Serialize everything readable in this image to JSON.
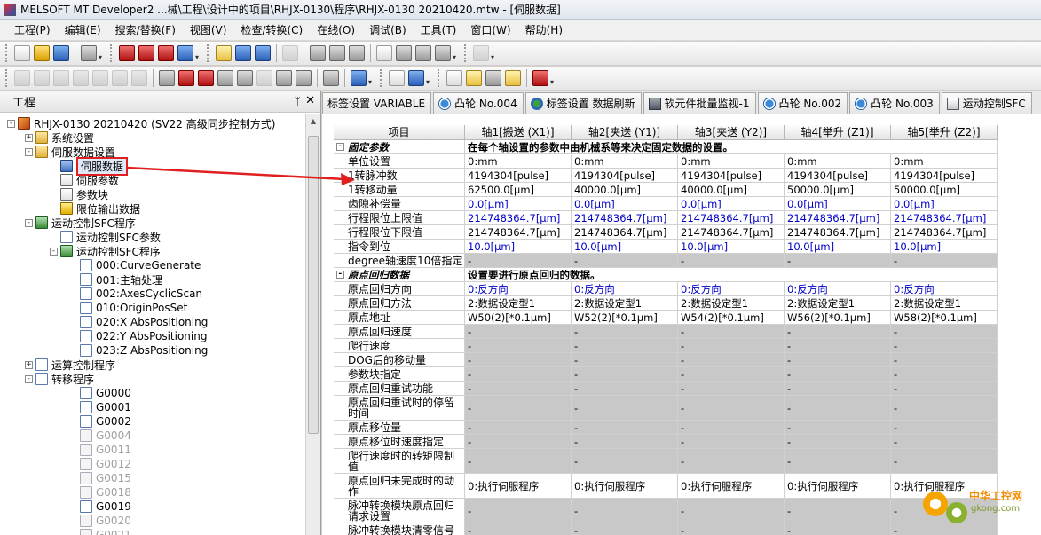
{
  "window": {
    "title": "MELSOFT MT Developer2 ...械\\工程\\设计中的项目\\RHJX-0130\\程序\\RHJX-0130 20210420.mtw - [伺服数据]"
  },
  "menu": [
    "工程(P)",
    "编辑(E)",
    "搜索/替换(F)",
    "视图(V)",
    "检查/转换(C)",
    "在线(O)",
    "调试(B)",
    "工具(T)",
    "窗口(W)",
    "帮助(H)"
  ],
  "panel": {
    "title": "工程",
    "pin": "ᛘ",
    "close": "✕"
  },
  "tree": [
    {
      "label": "RHJX-0130 20210420 (SV22 高级同步控制方式)",
      "indent": 0,
      "exp": "-",
      "icon": "proj"
    },
    {
      "label": "系统设置",
      "indent": 1,
      "exp": "+",
      "icon": "folder"
    },
    {
      "label": "伺服数据设置",
      "indent": 1,
      "exp": "-",
      "icon": "folder"
    },
    {
      "label": "伺服数据",
      "indent": 2,
      "exp": "",
      "icon": "servo",
      "highlight": true
    },
    {
      "label": "伺服参数",
      "indent": 2,
      "exp": "",
      "icon": "blk"
    },
    {
      "label": "参数块",
      "indent": 2,
      "exp": "",
      "icon": "blk"
    },
    {
      "label": "限位输出数据",
      "indent": 2,
      "exp": "",
      "icon": "yel"
    },
    {
      "label": "运动控制SFC程序",
      "indent": 1,
      "exp": "-",
      "icon": "sfc"
    },
    {
      "label": "运动控制SFC参数",
      "indent": 2,
      "exp": "",
      "icon": "doc"
    },
    {
      "label": "运动控制SFC程序",
      "indent": 2,
      "exp": "-",
      "icon": "sfc"
    },
    {
      "label": "000:CurveGenerate",
      "indent": 3,
      "exp": "",
      "icon": "doc"
    },
    {
      "label": "001:主轴处理",
      "indent": 3,
      "exp": "",
      "icon": "doc"
    },
    {
      "label": "002:AxesCyclicScan",
      "indent": 3,
      "exp": "",
      "icon": "doc"
    },
    {
      "label": "010:OriginPosSet",
      "indent": 3,
      "exp": "",
      "icon": "doc"
    },
    {
      "label": "020:X AbsPositioning",
      "indent": 3,
      "exp": "",
      "icon": "doc"
    },
    {
      "label": "022:Y AbsPositioning",
      "indent": 3,
      "exp": "",
      "icon": "doc"
    },
    {
      "label": "023:Z AbsPositioning",
      "indent": 3,
      "exp": "",
      "icon": "doc"
    },
    {
      "label": "运算控制程序",
      "indent": 1,
      "exp": "+",
      "icon": "doc"
    },
    {
      "label": "转移程序",
      "indent": 1,
      "exp": "-",
      "icon": "doc"
    },
    {
      "label": "G0000",
      "indent": 3,
      "exp": "",
      "icon": "doc"
    },
    {
      "label": "G0001",
      "indent": 3,
      "exp": "",
      "icon": "doc"
    },
    {
      "label": "G0002",
      "indent": 3,
      "exp": "",
      "icon": "doc"
    },
    {
      "label": "G0004",
      "indent": 3,
      "exp": "",
      "icon": "gdoc",
      "dim": true
    },
    {
      "label": "G0011",
      "indent": 3,
      "exp": "",
      "icon": "gdoc",
      "dim": true
    },
    {
      "label": "G0012",
      "indent": 3,
      "exp": "",
      "icon": "gdoc",
      "dim": true
    },
    {
      "label": "G0015",
      "indent": 3,
      "exp": "",
      "icon": "gdoc",
      "dim": true
    },
    {
      "label": "G0018",
      "indent": 3,
      "exp": "",
      "icon": "gdoc",
      "dim": true
    },
    {
      "label": "G0019",
      "indent": 3,
      "exp": "",
      "icon": "doc"
    },
    {
      "label": "G0020",
      "indent": 3,
      "exp": "",
      "icon": "gdoc",
      "dim": true
    },
    {
      "label": "G0021",
      "indent": 3,
      "exp": "",
      "icon": "gdoc",
      "dim": true
    }
  ],
  "tabs": [
    {
      "label": "标签设置 VARIABLE",
      "icon": ""
    },
    {
      "label": "凸轮 No.004",
      "icon": "cam"
    },
    {
      "label": "标签设置 数据刷新",
      "icon": "refresh"
    },
    {
      "label": "软元件批量监视-1",
      "icon": "dev"
    },
    {
      "label": "凸轮 No.002",
      "icon": "cam"
    },
    {
      "label": "凸轮 No.003",
      "icon": "cam"
    },
    {
      "label": "运动控制SFC",
      "icon": "sfc"
    }
  ],
  "grid": {
    "headers": [
      "项目",
      "轴1[搬送 (X1)]",
      "轴2[夹送 (Y1)]",
      "轴3[夹送 (Y2)]",
      "轴4[举升 (Z1)]",
      "轴5[举升 (Z2)]"
    ],
    "rows": [
      {
        "type": "section",
        "label": "固定参数",
        "desc": "在每个轴设置的参数中由机械系等来决定固定数据的设置。"
      },
      {
        "label": "单位设置",
        "values": [
          "0:mm",
          "0:mm",
          "0:mm",
          "0:mm",
          "0:mm"
        ]
      },
      {
        "label": "1转脉冲数",
        "values": [
          "4194304[pulse]",
          "4194304[pulse]",
          "4194304[pulse]",
          "4194304[pulse]",
          "4194304[pulse]"
        ]
      },
      {
        "label": "1转移动量",
        "values": [
          "62500.0[μm]",
          "40000.0[μm]",
          "40000.0[μm]",
          "50000.0[μm]",
          "50000.0[μm]"
        ]
      },
      {
        "label": "齿隙补偿量",
        "values": [
          "0.0[μm]",
          "0.0[μm]",
          "0.0[μm]",
          "0.0[μm]",
          "0.0[μm]"
        ],
        "blue": true
      },
      {
        "label": "行程限位上限值",
        "values": [
          "214748364.7[μm]",
          "214748364.7[μm]",
          "214748364.7[μm]",
          "214748364.7[μm]",
          "214748364.7[μm]"
        ],
        "blue": true
      },
      {
        "label": "行程限位下限值",
        "values": [
          "214748364.7[μm]",
          "214748364.7[μm]",
          "214748364.7[μm]",
          "214748364.7[μm]",
          "214748364.7[μm]"
        ]
      },
      {
        "label": "指令到位",
        "values": [
          "10.0[μm]",
          "10.0[μm]",
          "10.0[μm]",
          "10.0[μm]",
          "10.0[μm]"
        ],
        "blue": true
      },
      {
        "label": "degree轴速度10倍指定",
        "values": [
          "-",
          "-",
          "-",
          "-",
          "-"
        ],
        "gray": true
      },
      {
        "type": "section",
        "label": "原点回归数据",
        "desc": "设置要进行原点回归的数据。"
      },
      {
        "label": "原点回归方向",
        "values": [
          "0:反方向",
          "0:反方向",
          "0:反方向",
          "0:反方向",
          "0:反方向"
        ],
        "blue": true
      },
      {
        "label": "原点回归方法",
        "values": [
          "2:数据设定型1",
          "2:数据设定型1",
          "2:数据设定型1",
          "2:数据设定型1",
          "2:数据设定型1"
        ]
      },
      {
        "label": "原点地址",
        "values": [
          "W50(2)[*0.1μm]",
          "W52(2)[*0.1μm]",
          "W54(2)[*0.1μm]",
          "W56(2)[*0.1μm]",
          "W58(2)[*0.1μm]"
        ]
      },
      {
        "label": "原点回归速度",
        "values": [
          "-",
          "-",
          "-",
          "-",
          "-"
        ],
        "gray": true
      },
      {
        "label": "爬行速度",
        "values": [
          "-",
          "-",
          "-",
          "-",
          "-"
        ],
        "gray": true
      },
      {
        "label": "DOG后的移动量",
        "values": [
          "-",
          "-",
          "-",
          "-",
          "-"
        ],
        "gray": true
      },
      {
        "label": "参数块指定",
        "values": [
          "-",
          "-",
          "-",
          "-",
          "-"
        ],
        "gray": true
      },
      {
        "label": "原点回归重试功能",
        "values": [
          "-",
          "-",
          "-",
          "-",
          "-"
        ],
        "gray": true
      },
      {
        "label": "原点回归重试时的停留时间",
        "values": [
          "-",
          "-",
          "-",
          "-",
          "-"
        ],
        "gray": true,
        "tall": true
      },
      {
        "label": "原点移位量",
        "values": [
          "-",
          "-",
          "-",
          "-",
          "-"
        ],
        "gray": true
      },
      {
        "label": "原点移位时速度指定",
        "values": [
          "-",
          "-",
          "-",
          "-",
          "-"
        ],
        "gray": true
      },
      {
        "label": "爬行速度时的转矩限制值",
        "values": [
          "-",
          "-",
          "-",
          "-",
          "-"
        ],
        "gray": true,
        "tall": true
      },
      {
        "label": "原点回归未完成时的动作",
        "values": [
          "0:执行伺服程序",
          "0:执行伺服程序",
          "0:执行伺服程序",
          "0:执行伺服程序",
          "0:执行伺服程序"
        ],
        "tall": true
      },
      {
        "label": "脉冲转换模块原点回归请求设置",
        "values": [
          "-",
          "-",
          "-",
          "-",
          "-"
        ],
        "gray": true,
        "tall": true
      },
      {
        "label": "脉冲转换模块清零信号",
        "values": [
          "-",
          "-",
          "-",
          "-",
          "-"
        ],
        "gray": true
      }
    ]
  },
  "watermark": {
    "text": "中华工控网",
    "url": "gkong.com"
  }
}
